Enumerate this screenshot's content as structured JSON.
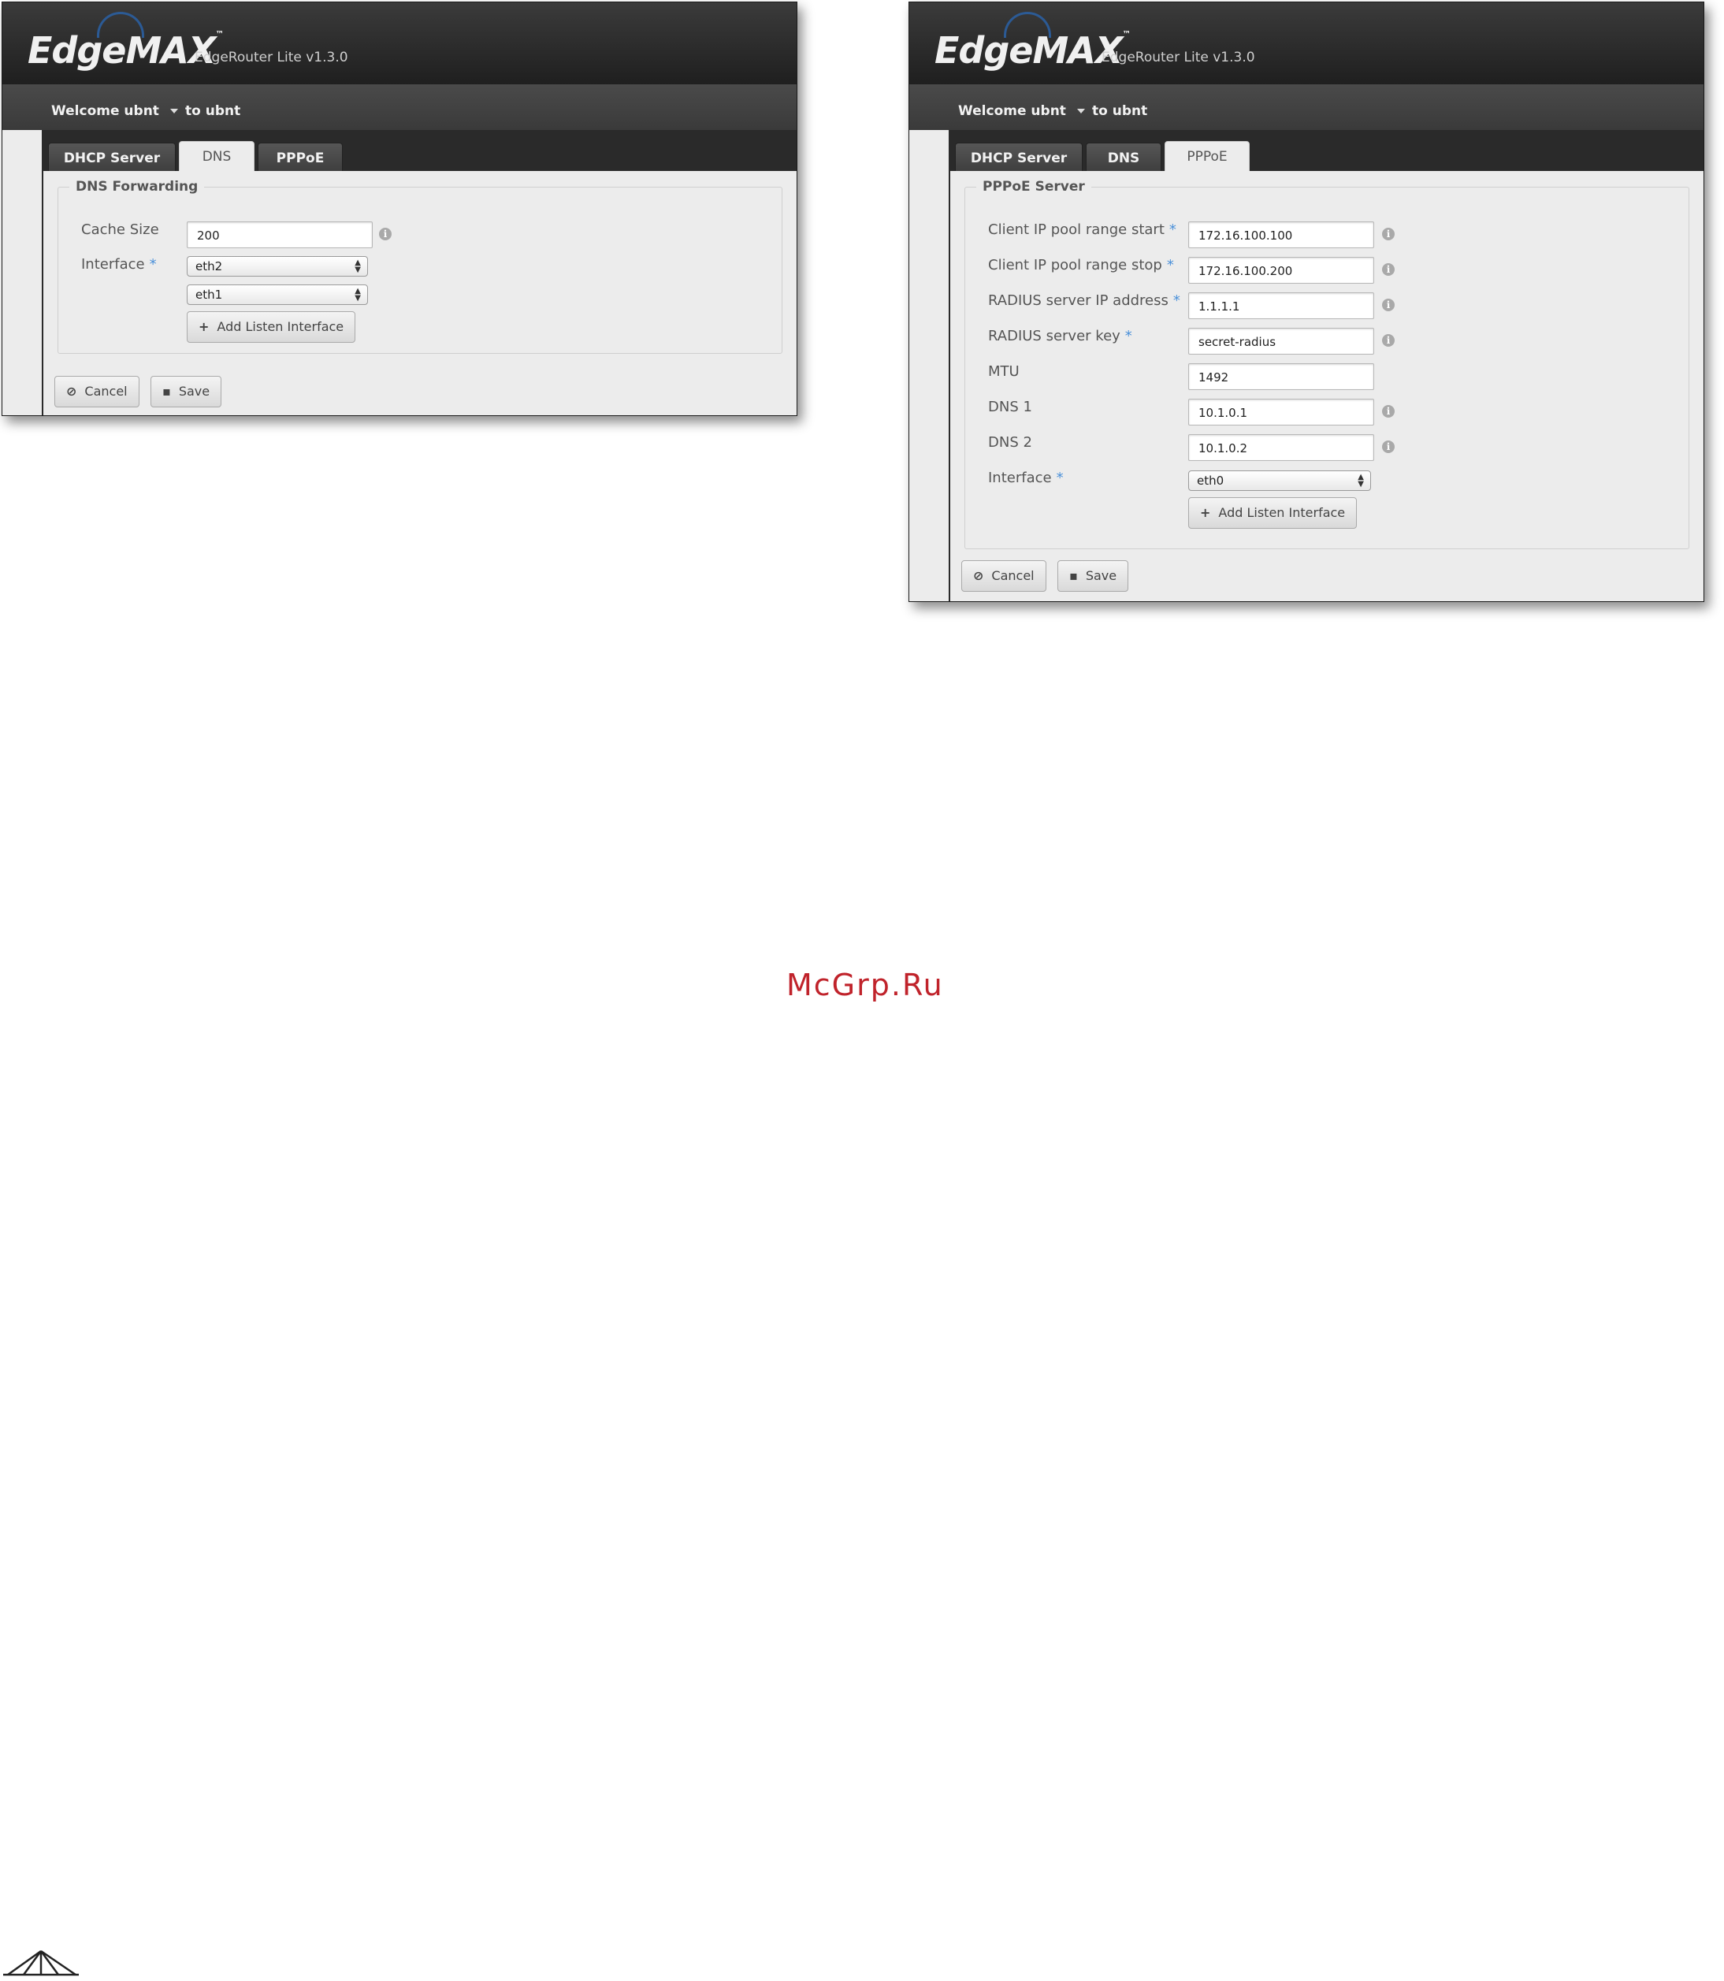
{
  "brand": {
    "logo": "EdgeMAX",
    "tm": "™",
    "product": "EdgeRouter Lite v1.3.0"
  },
  "userbar": {
    "welcome": "Welcome ubnt",
    "to": "to ubnt"
  },
  "tabs": [
    "DHCP Server",
    "DNS",
    "PPPoE"
  ],
  "dns": {
    "legend": "DNS Forwarding",
    "cache_label": "Cache Size",
    "cache_value": "200",
    "interface_label": "Interface",
    "interfaces": [
      "eth2",
      "eth1"
    ],
    "add_label": "Add Listen Interface"
  },
  "pppoe": {
    "legend": "PPPoE Server",
    "fields": [
      {
        "label": "Client IP pool range start",
        "required": "*",
        "value": "172.16.100.100"
      },
      {
        "label": "Client IP pool range stop",
        "required": "*",
        "value": "172.16.100.200"
      },
      {
        "label": "RADIUS server IP address",
        "required": "*",
        "value": "1.1.1.1"
      },
      {
        "label": "RADIUS server key",
        "required": "*",
        "value": "secret-radius"
      },
      {
        "label": "MTU",
        "required": "",
        "value": "1492"
      },
      {
        "label": "DNS 1",
        "required": "",
        "value": "10.1.0.1"
      },
      {
        "label": "DNS 2",
        "required": "",
        "value": "10.1.0.2"
      }
    ],
    "interface_label": "Interface",
    "interface_value": "eth0",
    "add_label": "Add Listen Interface"
  },
  "actions": {
    "cancel": "Cancel",
    "save": "Save"
  },
  "required_mark": "*",
  "info_mark": "i",
  "watermark": "McGrp.Ru",
  "colors": {
    "accent": "#4a90d9",
    "watermark": "#c0232b",
    "header": "#2a2a2a"
  }
}
